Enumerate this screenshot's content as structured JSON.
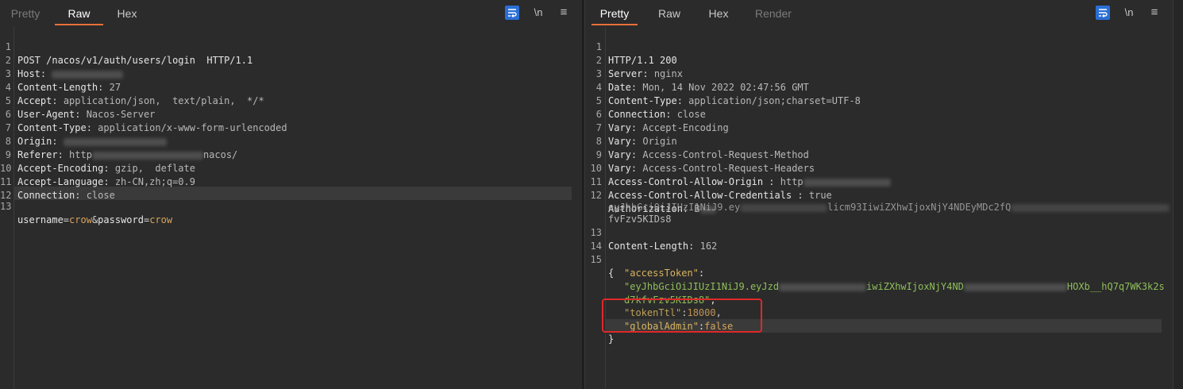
{
  "request": {
    "tabs": [
      "Pretty",
      "Raw",
      "Hex"
    ],
    "active_tab": "Raw",
    "tools": {
      "newline": "\\n",
      "menu": "≡"
    },
    "lines": [
      {
        "n": "1",
        "text": "POST /nacos/v1/auth/users/login  HTTP/1.1"
      },
      {
        "n": "2",
        "name": "Host",
        "value": ""
      },
      {
        "n": "3",
        "name": "Content-Length",
        "value": "27"
      },
      {
        "n": "4",
        "name": "Accept",
        "value": "application/json,  text/plain,  */*"
      },
      {
        "n": "5",
        "name": "User-Agent",
        "value": "Nacos-Server"
      },
      {
        "n": "6",
        "name": "Content-Type",
        "value": "application/x-www-form-urlencoded"
      },
      {
        "n": "7",
        "name": "Origin",
        "value": ""
      },
      {
        "n": "8",
        "name": "Referer",
        "value": "http",
        "value_tail": "nacos/"
      },
      {
        "n": "9",
        "name": "Accept-Encoding",
        "value": "gzip,  deflate"
      },
      {
        "n": "10",
        "name": "Accept-Language",
        "value": "zh-CN,zh;q=0.9"
      },
      {
        "n": "11",
        "name": "Connection",
        "value": "close"
      },
      {
        "n": "12",
        "text": ""
      },
      {
        "n": "13",
        "body": {
          "k1": "username",
          "v1": "crow",
          "amp": "&",
          "k2": "password",
          "v2": "crow",
          "eq": "="
        }
      }
    ]
  },
  "response": {
    "tabs": [
      "Pretty",
      "Raw",
      "Hex",
      "Render"
    ],
    "active_tab": "Pretty",
    "tools": {
      "newline": "\\n",
      "menu": "≡"
    },
    "lines": [
      {
        "n": "1",
        "text": "HTTP/1.1 200"
      },
      {
        "n": "2",
        "name": "Server",
        "value": "nginx"
      },
      {
        "n": "3",
        "name": "Date",
        "value": "Mon, 14 Nov 2022 02:47:56 GMT"
      },
      {
        "n": "4",
        "name": "Content-Type",
        "value": "application/json;charset=UTF-8"
      },
      {
        "n": "5",
        "name": "Connection",
        "value": "close"
      },
      {
        "n": "6",
        "name": "Vary",
        "value": "Accept-Encoding"
      },
      {
        "n": "7",
        "name": "Vary",
        "value": "Origin"
      },
      {
        "n": "8",
        "name": "Vary",
        "value": "Access-Control-Request-Method"
      },
      {
        "n": "9",
        "name": "Vary",
        "value": "Access-Control-Request-Headers"
      },
      {
        "n": "10",
        "name": "Access-Control-Allow-Origin ",
        "value": "http"
      },
      {
        "n": "11",
        "name": "Access-Control-Allow-Credentials ",
        "value": "true"
      },
      {
        "n": "12",
        "name": "Authorization",
        "value": "B",
        "cont1": "eyJhbGciOiJIUzI1NiJ9.ey",
        "cont1_tail": "licm93IiwiZXhwIjoxNjY4NDEyMDc2fQ",
        "cont2": "fvFzv5KIDs8"
      },
      {
        "n": "13",
        "name": "Content-Length",
        "value": "162"
      },
      {
        "n": "14",
        "text": ""
      },
      {
        "n": "15",
        "text": "{"
      }
    ],
    "json": {
      "access_token_key": "\"accessToken\"",
      "access_token_val_1": "\"eyJhbGciOiJIUzI1NiJ9.eyJzd",
      "access_token_val_1_mid": "iwiZXhwIjoxNjY4ND",
      "access_token_val_1_tail": "HOXb__hQ7q7WK3k2s",
      "access_token_val_2": "d7kfvFzv5KIDs8\"",
      "token_ttl_key": "\"tokenTtl\"",
      "token_ttl_val": "18000",
      "global_admin_key": "\"globalAdmin\"",
      "global_admin_val": "false",
      "close_brace": "}",
      "colon": ":",
      "comma": ","
    }
  },
  "colors": {
    "accent": "#e8703a",
    "highlight_box": "#e02828",
    "wrap_button": "#2a6fd6"
  }
}
